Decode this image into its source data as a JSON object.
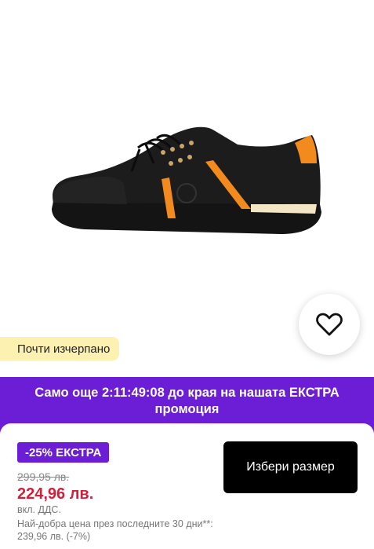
{
  "product": {
    "image_name": "black-sneaker-orange-accents",
    "stock_badge": "Почти изчерпано",
    "wishlist_icon": "heart-icon"
  },
  "promo": {
    "text": "Само още 2:11:49:08 до края на нашата ЕКСТРА промоция",
    "color": "#6c1ed6"
  },
  "pricing": {
    "discount_badge": "-25% ЕКСТРА",
    "old_price": "299,95 лв.",
    "new_price": "224,96 лв.",
    "vat_note": "вкл. ДДС.",
    "best_price_note": "Най-добра цена през последните 30 дни**: 239,96 лв. (-7%)",
    "price_color": "#d41e3a"
  },
  "actions": {
    "select_size_label": "Избери размер"
  }
}
